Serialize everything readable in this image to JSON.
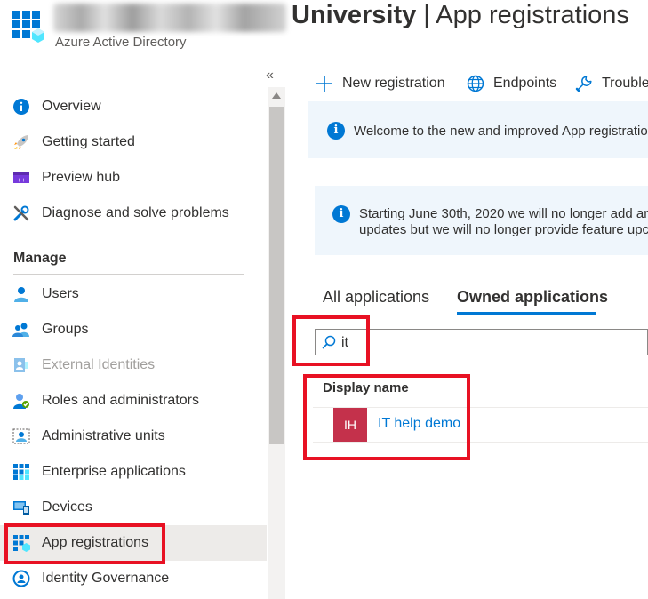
{
  "header": {
    "title_bold": "University",
    "title_rest": " | App registrations",
    "subtitle": "Azure Active Directory"
  },
  "sidebar": {
    "collapse_glyph": "«",
    "section_manage": "Manage",
    "items": [
      {
        "label": "Overview",
        "icon": "info-icon"
      },
      {
        "label": "Getting started",
        "icon": "rocket-icon"
      },
      {
        "label": "Preview hub",
        "icon": "preview-hub-icon"
      },
      {
        "label": "Diagnose and solve problems",
        "icon": "wrench-icon"
      },
      {
        "label": "Users",
        "icon": "user-icon"
      },
      {
        "label": "Groups",
        "icon": "groups-icon"
      },
      {
        "label": "External Identities",
        "icon": "external-identities-icon"
      },
      {
        "label": "Roles and administrators",
        "icon": "roles-icon"
      },
      {
        "label": "Administrative units",
        "icon": "admin-units-icon"
      },
      {
        "label": "Enterprise applications",
        "icon": "enterprise-apps-icon"
      },
      {
        "label": "Devices",
        "icon": "devices-icon"
      },
      {
        "label": "App registrations",
        "icon": "app-registrations-icon"
      },
      {
        "label": "Identity Governance",
        "icon": "identity-governance-icon"
      }
    ]
  },
  "toolbar": {
    "new_registration": "New registration",
    "endpoints": "Endpoints",
    "troubleshooting": "Trouble"
  },
  "banners": {
    "welcome": "Welcome to the new and improved App registratio",
    "notice_line1": "Starting June 30th, 2020 we will no longer add an",
    "notice_line2": "updates but we will no longer provide feature upc"
  },
  "tabs": {
    "all": "All applications",
    "owned": "Owned applications"
  },
  "search": {
    "value": "it"
  },
  "table": {
    "column_display_name": "Display name",
    "rows": [
      {
        "initials": "IH",
        "name": "IT help demo",
        "avatar_color": "#c4314b"
      }
    ]
  },
  "colors": {
    "accent": "#0078d4",
    "highlight": "#e81123",
    "selected_bg": "#edebe9"
  }
}
